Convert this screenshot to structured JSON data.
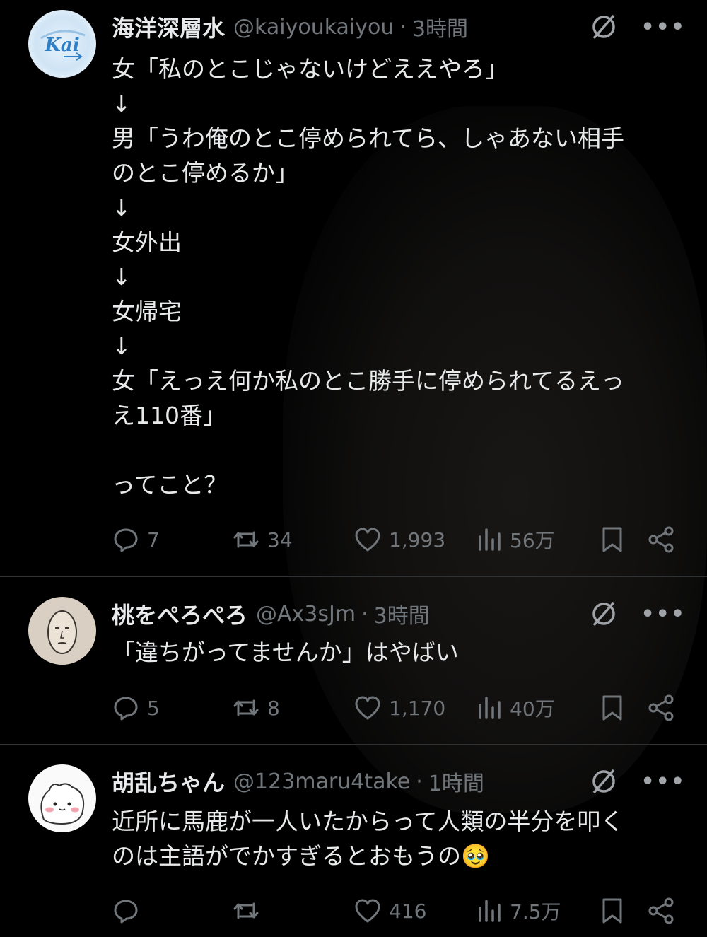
{
  "tweets": [
    {
      "name": "海洋深層水",
      "handle": "@kaiyoukaiyou",
      "time": "3時間",
      "avatar_text": "Kai",
      "lines": [
        "女「私のとこじゃないけどええやろ」",
        "↓",
        "男「うわ俺のとこ停められてら、しゃあない相手",
        "のとこ停めるか」",
        "↓",
        "女外出",
        "↓",
        "女帰宅",
        "↓",
        "女「えっえ何か私のとこ勝手に停められてるえっ",
        "え110番」",
        "",
        "ってこと？"
      ],
      "replies": "7",
      "retweets": "34",
      "likes": "1,993",
      "views": "56万"
    },
    {
      "name": "桃をぺろぺろ",
      "handle": "@Ax3sJm",
      "time": "3時間",
      "lines": [
        "「違ちがってませんか」はやばい"
      ],
      "replies": "5",
      "retweets": "8",
      "likes": "1,170",
      "views": "40万"
    },
    {
      "name": "胡乱ちゃん",
      "handle": "@123maru4take",
      "time": "1時間",
      "lines": [
        "近所に馬鹿が一人いたからって人類の半分を叩く",
        "のは主語がでかすぎるとおもうの🥹"
      ],
      "replies": "",
      "retweets": "",
      "likes": "416",
      "views": "7.5万"
    }
  ],
  "dot_separator": "·",
  "icons": [
    "grok-icon",
    "more-icon",
    "reply-icon",
    "retweet-icon",
    "like-icon",
    "views-icon",
    "bookmark-icon",
    "share-icon"
  ]
}
